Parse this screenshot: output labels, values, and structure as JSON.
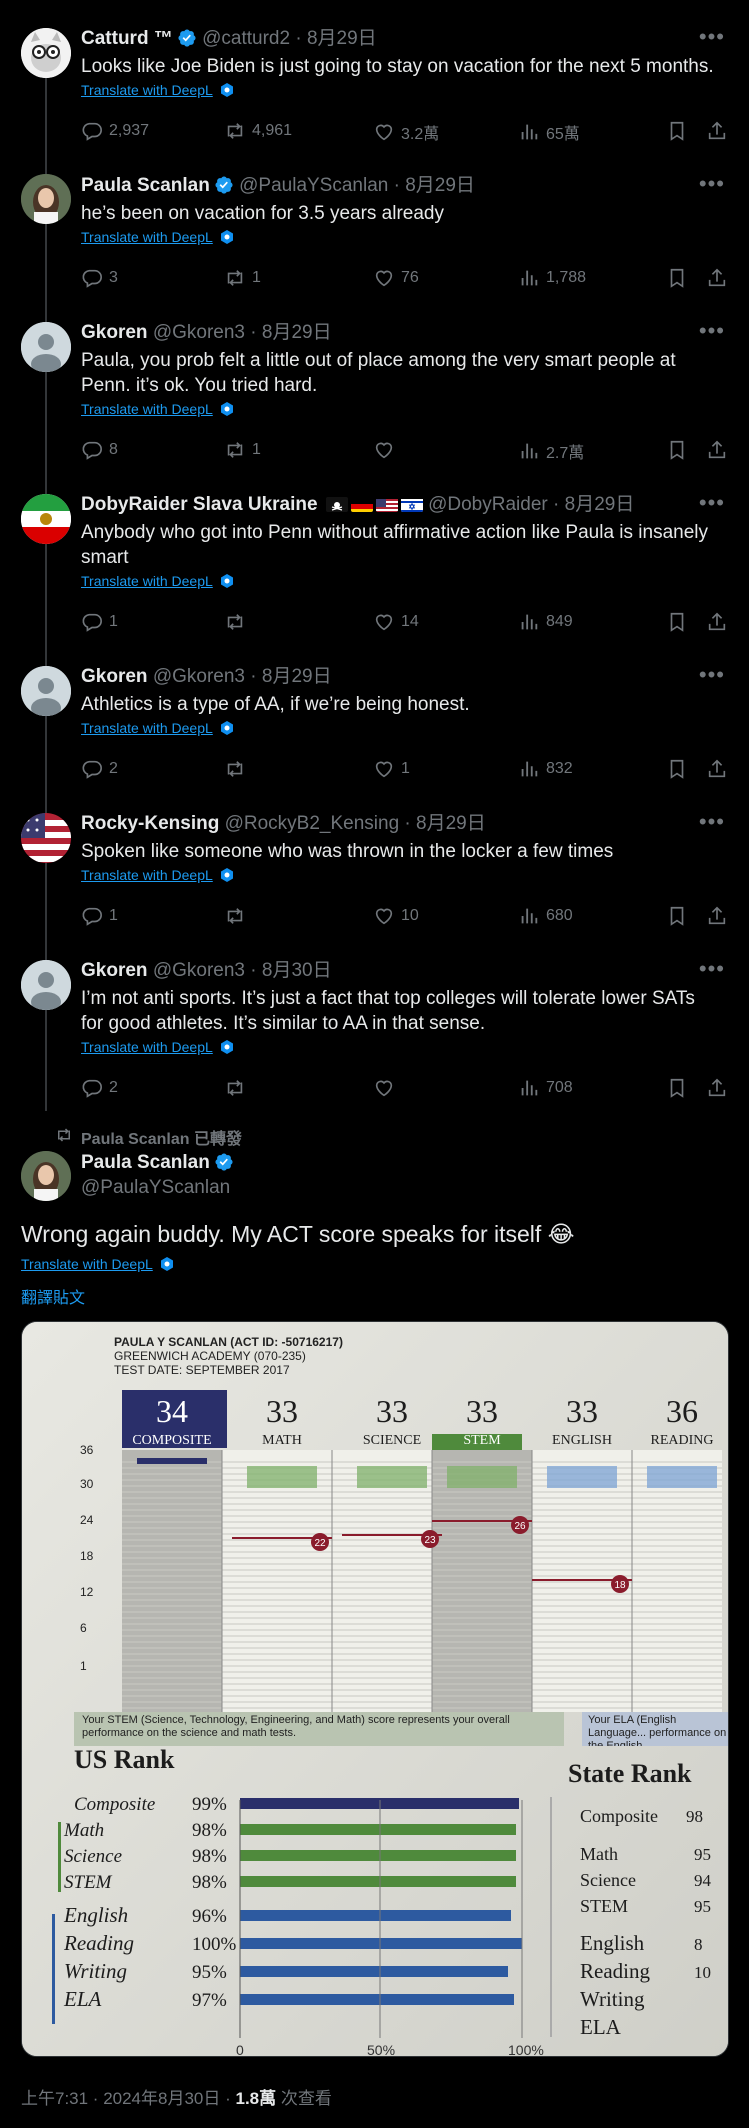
{
  "replies": [
    {
      "name": "Catturd ™",
      "handle": "@catturd2",
      "date": "8月29日",
      "verified": true,
      "lines": [
        "Looks like Joe Biden is just going to stay on vacation for the next 5 months."
      ],
      "translate": "Translate with DeepL",
      "stats": {
        "replies": "2,937",
        "reposts": "4,961",
        "likes": "3.2萬",
        "views": "65萬"
      }
    },
    {
      "name": "Paula Scanlan",
      "handle": "@PaulaYScanlan",
      "date": "8月29日",
      "verified": true,
      "lines": [
        "he’s been on vacation for 3.5 years already"
      ],
      "translate": "Translate with DeepL",
      "stats": {
        "replies": "3",
        "reposts": "1",
        "likes": "76",
        "views": "1,788"
      }
    },
    {
      "name": "Gkoren",
      "handle": "@Gkoren3",
      "date": "8月29日",
      "verified": false,
      "lines": [
        "Paula, you prob felt a little out of place among the very smart people at",
        "Penn. it’s ok. You tried hard."
      ],
      "translate": "Translate with DeepL",
      "stats": {
        "replies": "8",
        "reposts": "1",
        "likes": "",
        "views": "2.7萬"
      }
    },
    {
      "name": "DobyRaider Slava Ukraine",
      "handle": "@DobyRaider",
      "date": "8月29日",
      "verified": false,
      "lines": [
        "Anybody who got into Penn without affirmative action like Paula is insanely",
        "smart"
      ],
      "translate": "Translate with DeepL",
      "stats": {
        "replies": "1",
        "reposts": "",
        "likes": "14",
        "views": "849"
      }
    },
    {
      "name": "Gkoren",
      "handle": "@Gkoren3",
      "date": "8月29日",
      "verified": false,
      "lines": [
        "Athletics is a type of AA, if we’re being honest."
      ],
      "translate": "Translate with DeepL",
      "stats": {
        "replies": "2",
        "reposts": "",
        "likes": "1",
        "views": "832"
      }
    },
    {
      "name": "Rocky-Kensing",
      "handle": "@RockyB2_Kensing",
      "date": "8月29日",
      "verified": false,
      "lines": [
        "Spoken like someone who was thrown in the locker a few times"
      ],
      "translate": "Translate with DeepL",
      "stats": {
        "replies": "1",
        "reposts": "",
        "likes": "10",
        "views": "680"
      }
    },
    {
      "name": "Gkoren",
      "handle": "@Gkoren3",
      "date": "8月30日",
      "verified": false,
      "lines": [
        "I’m not anti sports.  It’s just a fact that top colleges will tolerate lower SATs",
        "for good athletes. It’s similar to AA in that sense."
      ],
      "translate": "Translate with DeepL",
      "stats": {
        "replies": "2",
        "reposts": "",
        "likes": "",
        "views": "708"
      }
    }
  ],
  "main_post": {
    "retweet_label": "Paula Scanlan 已轉發",
    "name": "Paula Scanlan",
    "handle": "@PaulaYScanlan",
    "text": "Wrong again buddy. My ACT score speaks for itself 😂",
    "translate": "Translate with DeepL",
    "translate_post": "翻譯貼文",
    "time": "上午7:31 · 2024年8月30日 · ",
    "views": "1.8萬",
    "views_suffix": " 次查看"
  },
  "score_report": {
    "header": [
      "PAULA Y SCANLAN (ACT ID: -50716217)",
      "GREENWICH ACADEMY (070-235)",
      "TEST DATE: SEPTEMBER 2017"
    ],
    "scores": [
      {
        "score": "34",
        "label": "COMPOSITE"
      },
      {
        "score": "33",
        "label": "MATH"
      },
      {
        "score": "33",
        "label": "SCIENCE"
      },
      {
        "score": "33",
        "label": "STEM"
      },
      {
        "score": "33",
        "label": "ENGLISH"
      },
      {
        "score": "36",
        "label": "READING"
      }
    ],
    "y_ticks": [
      "36",
      "30",
      "24",
      "18",
      "12",
      "6",
      "1"
    ],
    "benchmarks": [
      "22",
      "23",
      "26",
      "18"
    ],
    "stem_note": "Your STEM (Science, Technology, Engineering, and Math) score represents your overall performance on the science and math tests.",
    "ela_note": "Your ELA (English Language... performance on the English,",
    "us_rank_title": "US Rank",
    "state_rank_title": "State Rank",
    "us_rank": [
      {
        "label": "Composite",
        "value": "99%"
      },
      {
        "label": "Math",
        "value": "98%"
      },
      {
        "label": "Science",
        "value": "98%"
      },
      {
        "label": "STEM",
        "value": "98%"
      },
      {
        "label": "English",
        "value": "96%"
      },
      {
        "label": "Reading",
        "value": "100%"
      },
      {
        "label": "Writing",
        "value": "95%"
      },
      {
        "label": "ELA",
        "value": "97%"
      }
    ],
    "state_rank": [
      {
        "label": "Composite",
        "value": "98"
      },
      {
        "label": "Math",
        "value": "95"
      },
      {
        "label": "Science",
        "value": "94"
      },
      {
        "label": "STEM",
        "value": "95"
      },
      {
        "label": "English",
        "value": "8"
      },
      {
        "label": "Reading",
        "value": "10"
      },
      {
        "label": "Writing",
        "value": ""
      },
      {
        "label": "ELA",
        "value": ""
      }
    ],
    "axis_ticks": [
      "0",
      "50%",
      "100%"
    ]
  }
}
